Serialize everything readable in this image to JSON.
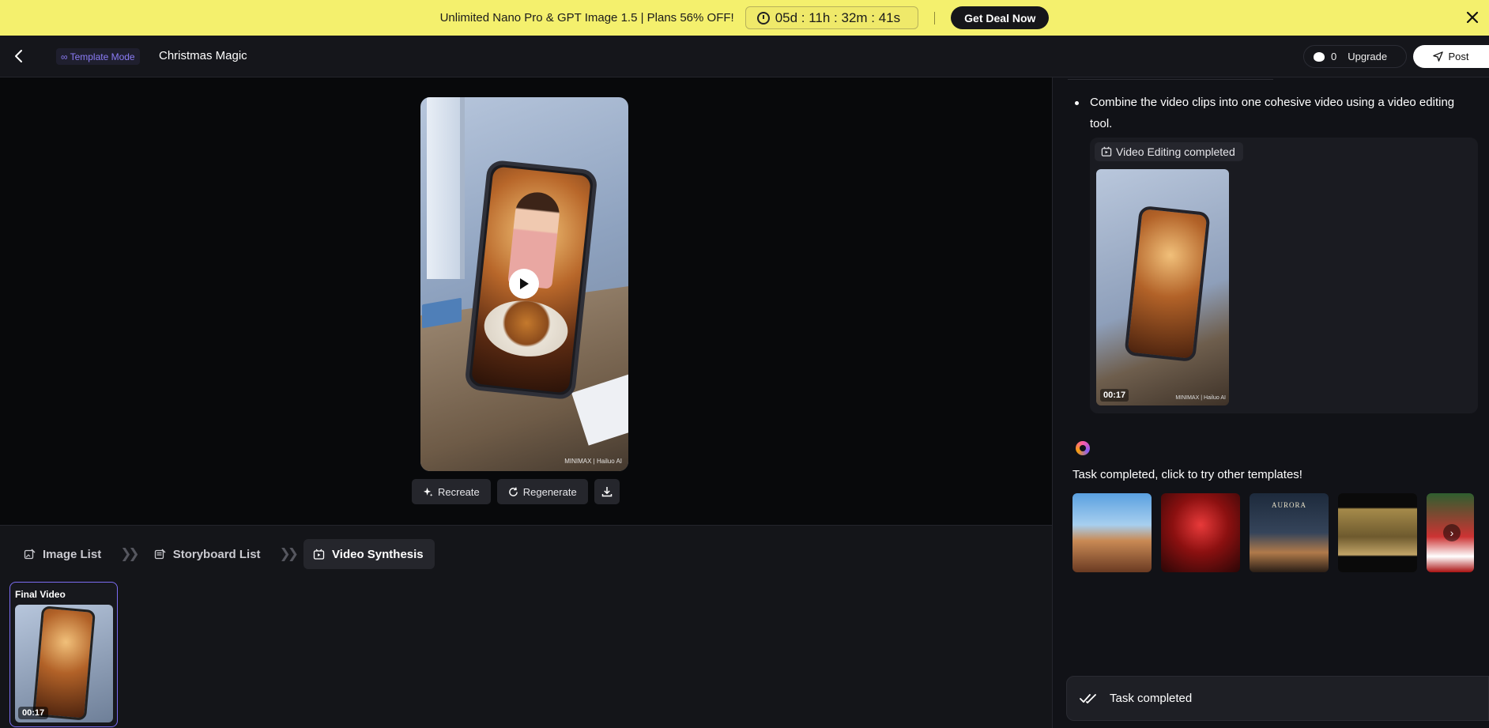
{
  "banner": {
    "text": "Unlimited Nano Pro & GPT Image 1.5 | Plans 56% OFF!",
    "countdown": "05d : 11h : 32m : 41s",
    "deal_label": "Get Deal Now"
  },
  "header": {
    "mode_tag": "Template Mode",
    "title": "Christmas Magic",
    "credits": "0",
    "upgrade_label": "Upgrade",
    "post_label": "Post"
  },
  "preview": {
    "watermark": "MINIMAX | Hailuo AI",
    "actions": {
      "recreate": "Recreate",
      "regenerate": "Regenerate"
    }
  },
  "steps": [
    {
      "label": "Image List"
    },
    {
      "label": "Storyboard List"
    },
    {
      "label": "Video Synthesis"
    }
  ],
  "final_video": {
    "label": "Final Video",
    "duration": "00:17"
  },
  "panel": {
    "step_text": "Combine the video clips into one cohesive video using a video editing tool.",
    "result_tag": "Video Editing completed",
    "result_duration": "00:17",
    "result_watermark": "MINIMAX | Hailuo AI",
    "done_text": "Task completed, click to try other templates!",
    "template_3_label": "AURORA",
    "task_status": "Task completed"
  },
  "colors": {
    "banner_bg": "#f4f06d",
    "accent": "#7b6cf2",
    "background": "#111217"
  }
}
